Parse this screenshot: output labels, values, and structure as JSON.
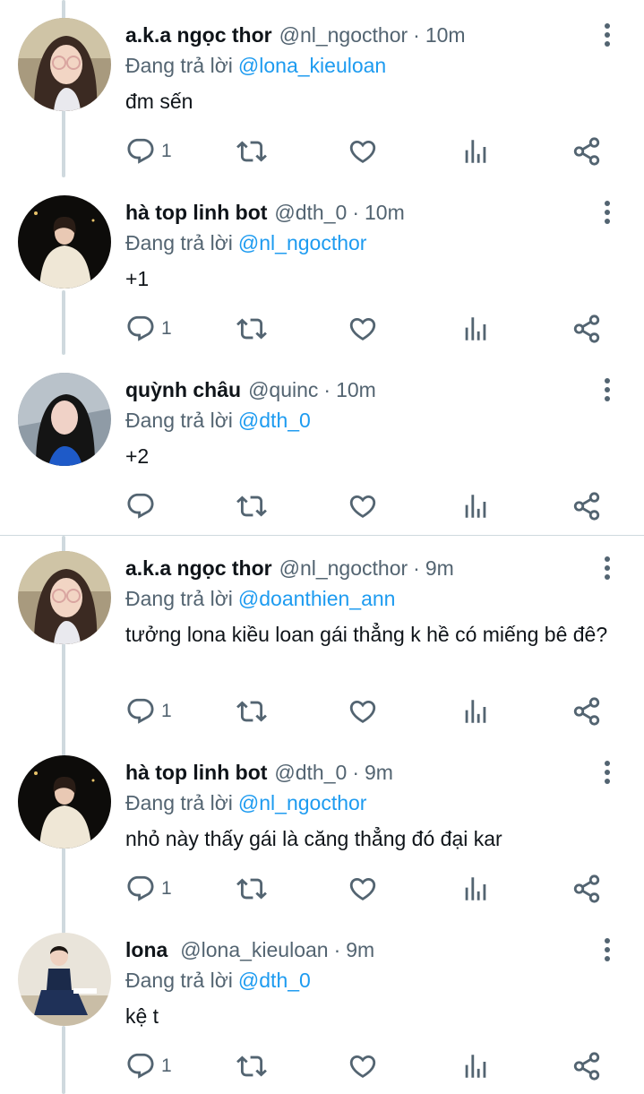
{
  "replying_prefix": "Đang trả lời",
  "colors": {
    "link": "#1d9bf0",
    "secondary_text": "#536471",
    "primary_text": "#0f1419",
    "thread_line": "#cfd9de"
  },
  "icons": [
    "reply-icon",
    "retweet-icon",
    "like-icon",
    "views-icon",
    "share-icon",
    "more-icon"
  ],
  "tweets": [
    {
      "name": "a.k.a ngọc thor",
      "handle": "@nl_ngocthor",
      "time": "10m",
      "reply_to": "@lona_kieuloan",
      "text": "đm sến",
      "reply_count": "1"
    },
    {
      "name": "hà top linh bot",
      "handle": "@dth_0",
      "time": "10m",
      "reply_to": "@nl_ngocthor",
      "text": "+1",
      "reply_count": "1"
    },
    {
      "name": "quỳnh châu",
      "handle": "@quinc",
      "time": "10m",
      "reply_to": "@dth_0",
      "text": "+2",
      "reply_count": ""
    },
    {
      "name": "a.k.a ngọc thor",
      "handle": "@nl_ngocthor",
      "time": "9m",
      "reply_to": "@doanthien_ann",
      "text": "tưởng lona kiều loan gái thẳng k hề có miếng bê đê?",
      "reply_count": "1"
    },
    {
      "name": "hà top linh bot",
      "handle": "@dth_0",
      "time": "9m",
      "reply_to": "@nl_ngocthor",
      "text": "nhỏ này thấy gái là căng thẳng đó đại kar",
      "reply_count": "1"
    },
    {
      "name": "lona",
      "handle": "@lona_kieuloan",
      "time": "9m",
      "reply_to": "@dth_0",
      "text": "kệ t",
      "reply_count": "1"
    }
  ]
}
